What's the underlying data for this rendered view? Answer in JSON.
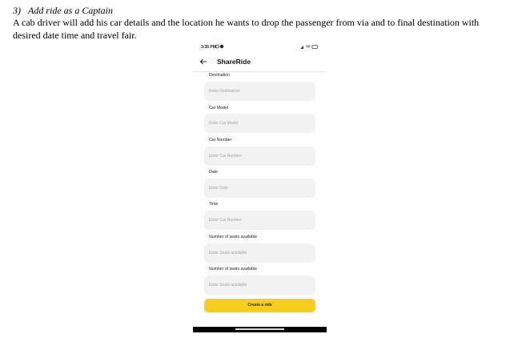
{
  "document": {
    "heading_number": "3)",
    "heading_text": "Add ride as a Captain",
    "body": "A cab driver will add his car details and the location he wants to drop the passenger from via and to final destination with desired date time and travel fair."
  },
  "phone": {
    "status_time": "3:35 PM",
    "app_title": "ShareRide",
    "fields": [
      {
        "label": "Destination",
        "placeholder": "Enter Destination"
      },
      {
        "label": "Car Model",
        "placeholder": "Enter Car Model"
      },
      {
        "label": "Car Number",
        "placeholder": "Enter Car Number"
      },
      {
        "label": "Date",
        "placeholder": "Enter Date"
      },
      {
        "label": "Time",
        "placeholder": "Enter Car Number"
      },
      {
        "label": "Number of seats available",
        "placeholder": "Enter Seats available"
      },
      {
        "label": "Number of seats available",
        "placeholder": "Enter Seats available"
      }
    ],
    "create_button": "Create a ride",
    "colors": {
      "accent": "#f9cd1b",
      "field_bg": "#f2f2f3"
    }
  }
}
